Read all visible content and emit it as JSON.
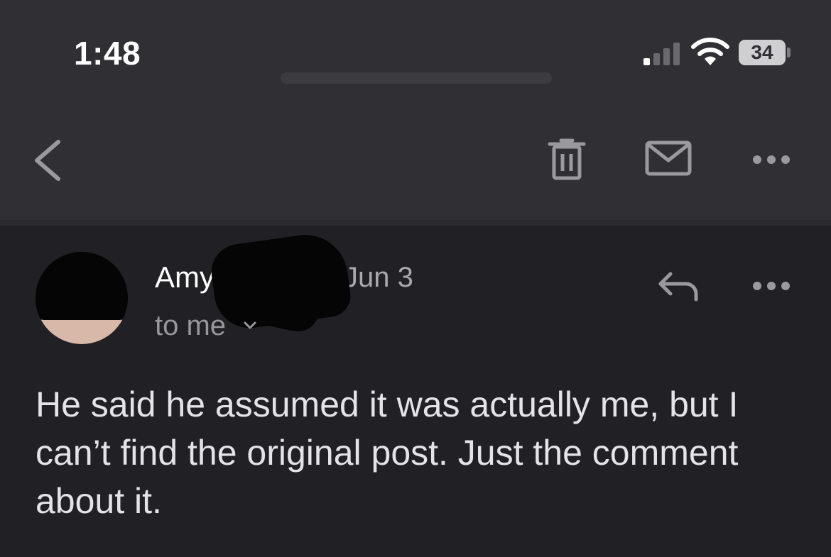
{
  "status_bar": {
    "time": "1:48",
    "battery": "34",
    "icons": [
      "cellular-signal-icon",
      "wifi-icon",
      "battery-icon"
    ]
  },
  "toolbar": {
    "icons": [
      "back-chevron-icon",
      "trash-icon",
      "mail-icon",
      "more-icon"
    ]
  },
  "message": {
    "sender": "Amy",
    "date": "Jun 3",
    "recipient": "to me",
    "body": "He said he assumed it was actually me, but I can’t find the original post. Just the comment about it."
  },
  "colors": {
    "background": "#212125",
    "chrome": "#303034",
    "text": "#e4e4e7",
    "muted": "#97979b"
  }
}
